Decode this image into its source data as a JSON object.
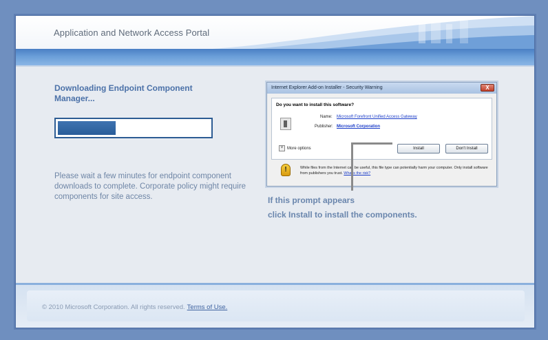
{
  "header": {
    "title": "Application and Network Access Portal"
  },
  "download": {
    "title": "Downloading Endpoint Component Manager...",
    "progress_percent": 38,
    "wait_message": "Please wait a few minutes for endpoint component downloads to complete. Corporate policy might require components for site access."
  },
  "dialog": {
    "title": "Internet Explorer Add-on Installer - Security Warning",
    "close_label": "X",
    "question": "Do you want to install this software?",
    "name_label": "Name:",
    "name_value": "Microsoft Forefront Unified Access Gateway",
    "publisher_label": "Publisher:",
    "publisher_value": "Microsoft Corporation",
    "more_options_toggle": "˅",
    "more_options_label": "More options",
    "install_button": "Install",
    "dont_install_button": "Don't Install",
    "warning_icon_glyph": "!",
    "warning_text": "While files from the Internet can be useful, this file type can potentially harm your computer. Only install software from publishers you trust.",
    "warning_link": "What's the risk?"
  },
  "instructions": {
    "line1": "If this prompt appears",
    "line2": "click Install to install the components."
  },
  "footer": {
    "copyright": "© 2010 Microsoft Corporation. All rights reserved.",
    "terms_link": "Terms of Use."
  },
  "colors": {
    "page_bg": "#6f8fbf",
    "band_blue": "#4a7fc4",
    "progress_fill": "#2a5d99",
    "title_blue": "#4b71a8",
    "muted_text": "#6f86a6"
  },
  "icons": [
    "package-icon",
    "warning-shield-icon",
    "close-icon",
    "chevron-down-icon"
  ]
}
